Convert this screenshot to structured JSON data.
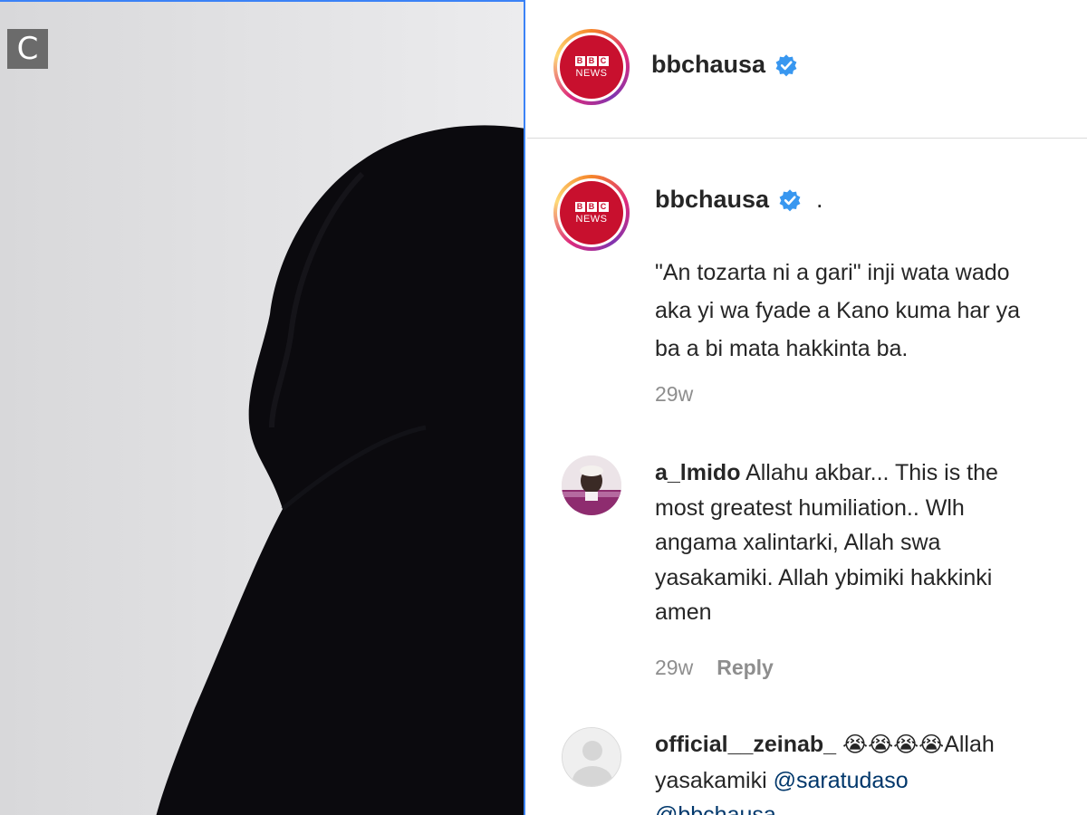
{
  "photo": {
    "badge_letter": "C",
    "colors": {
      "wall": "#e6e6e8",
      "garment": "#0b0a0e",
      "selection": "#3b82f6"
    }
  },
  "post": {
    "header": {
      "username": "bbchausa",
      "verified_icon": "verified-badge-icon",
      "avatar": {
        "blocks": [
          "B",
          "B",
          "C"
        ],
        "label": "NEWS"
      }
    },
    "caption": {
      "username": "bbchausa",
      "suffix": ".",
      "lines": [
        "\"An tozarta ni a gari\" inji wata wado",
        "aka yi wa fyade a Kano kuma har ya",
        "ba a bi mata hakkinta ba."
      ],
      "time": "29w"
    },
    "comments": [
      {
        "username": "a_lmido",
        "text_lines": [
          "Allahu akbar... This is the",
          "most greatest humiliation.. Wlh",
          "angama xalintarki, Allah swa",
          "yasakamiki. Allah ybimiki hakkinki",
          "amen"
        ],
        "time": "29w",
        "reply_label": "Reply"
      },
      {
        "username": "official__zeinab_",
        "emoji": "😭😭😭😭",
        "text_after_emoji": "Allah",
        "line2_text": "yasakamiki",
        "mention1": "@saratudaso",
        "mention2": "@bbchausa"
      }
    ]
  },
  "colors": {
    "brand_red": "#c8102e",
    "verified_blue": "#3897f0",
    "meta_gray": "#8e8e8e",
    "text": "#262626",
    "mention": "#00376b"
  }
}
